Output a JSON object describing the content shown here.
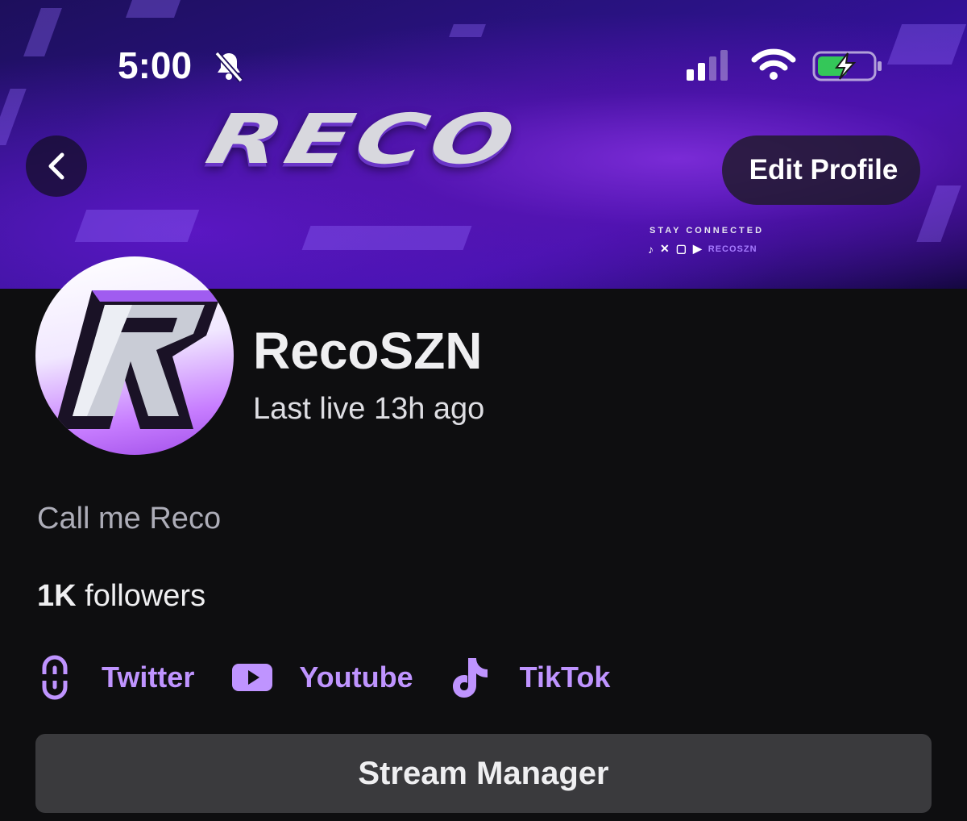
{
  "status_bar": {
    "time": "5:00"
  },
  "banner": {
    "logo_text": "RECO",
    "tagline": "STAY CONNECTED",
    "handle": "RECOSZN"
  },
  "header": {
    "edit_profile_label": "Edit Profile"
  },
  "profile": {
    "name": "RecoSZN",
    "last_live": "Last live 13h ago",
    "bio": "Call me Reco",
    "followers_count": "1K",
    "followers_label": "followers"
  },
  "links": [
    {
      "label": "Twitter",
      "icon": "link-icon"
    },
    {
      "label": "Youtube",
      "icon": "youtube-icon"
    },
    {
      "label": "TikTok",
      "icon": "tiktok-icon"
    }
  ],
  "actions": {
    "stream_manager_label": "Stream Manager"
  },
  "colors": {
    "accent": "#bf94ff",
    "background": "#0e0e10",
    "button": "#3a3a3d"
  }
}
